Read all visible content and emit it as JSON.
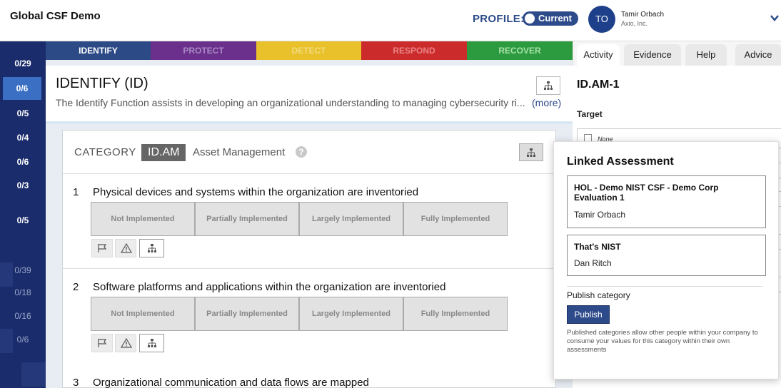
{
  "app": {
    "title": "Global CSF Demo"
  },
  "profile": {
    "label": "PROFILE:",
    "toggle_label": "Current"
  },
  "user": {
    "initials": "TO",
    "name": "Tamir Orbach",
    "org": "Axio, Inc."
  },
  "rail": {
    "items": [
      "0/29",
      "0/6",
      "0/5",
      "0/4",
      "0/6",
      "0/3",
      "0/5",
      "0/39",
      "0/18",
      "0/16",
      "0/6"
    ]
  },
  "function_tabs": [
    {
      "label": "IDENTIFY",
      "bg": "#2c4a86",
      "color": "#ffffff"
    },
    {
      "label": "PROTECT",
      "bg": "#6b2f8c",
      "color": "#a98bc6"
    },
    {
      "label": "DETECT",
      "bg": "#e8c12b",
      "color": "#f3da7e"
    },
    {
      "label": "RESPOND",
      "bg": "#cc2b2b",
      "color": "#e98585"
    },
    {
      "label": "RECOVER",
      "bg": "#2c9b3f",
      "color": "#a7e1a9"
    }
  ],
  "function": {
    "title": "IDENTIFY (ID)",
    "description": "The Identify Function assists in developing an organizational understanding to managing cybersecurity ri...",
    "more": "(more)"
  },
  "category": {
    "word": "CATEGORY",
    "code": "ID.AM",
    "name": "Asset Management",
    "help": "?"
  },
  "items": [
    {
      "num": "1",
      "text": "Physical devices and systems within the organization are inventoried"
    },
    {
      "num": "2",
      "text": "Software platforms and applications within the organization are inventoried"
    },
    {
      "num": "3",
      "text": "Organizational communication and data flows are mapped"
    }
  ],
  "ratings": [
    "Not Implemented",
    "Partially Implemented",
    "Largely Implemented",
    "Fully Implemented"
  ],
  "right_panel": {
    "tabs": [
      "Activity",
      "Evidence",
      "Help",
      "Advice"
    ],
    "active_tab": "Activity",
    "code": "ID.AM-1",
    "target_label": "Target",
    "target_value": "None"
  },
  "popover": {
    "title": "Linked Assessment",
    "assessments": [
      {
        "name": "HOL - Demo NIST CSF - Demo Corp Evaluation 1",
        "user": "Tamir Orbach"
      },
      {
        "name": "That's NIST",
        "user": "Dan Ritch"
      }
    ],
    "publish_label": "Publish category",
    "publish_button": "Publish",
    "publish_help": "Published categories allow other people within your company to consume your values for this category within their own assessments"
  },
  "colors": {
    "brand": "#2d4a8a",
    "rail": "#1a2c6b",
    "rail_active": "#3a6fc4"
  }
}
